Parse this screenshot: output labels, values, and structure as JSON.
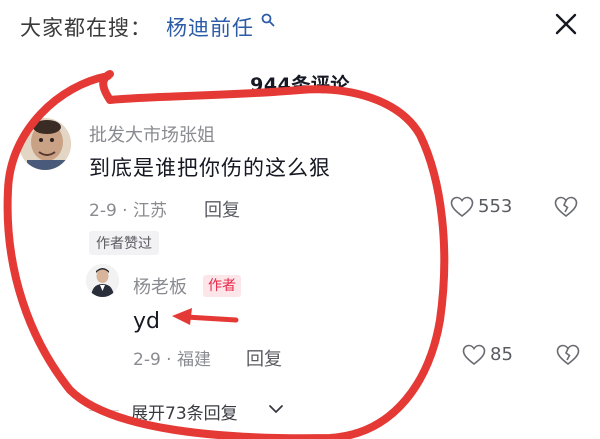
{
  "search": {
    "prefix": "大家都在搜：",
    "keyword": "杨迪前任"
  },
  "comments_header": {
    "count_label": "944条评论"
  },
  "comment": {
    "username": "批发大市场张姐",
    "text": "到底是谁把你伤的这么狠",
    "date_location": "2-9 · 江苏",
    "reply_label": "回复",
    "like_count": "553",
    "liked_by_author_badge": "作者赞过"
  },
  "reply": {
    "username": "杨老板",
    "author_badge": "作者",
    "text": "yd",
    "date_location": "2-9 · 福建",
    "reply_label": "回复",
    "like_count": "85"
  },
  "expand": {
    "label": "展开73条回复"
  },
  "colors": {
    "keyword": "#2c5ba8",
    "author_badge_bg": "#fde6ea",
    "author_badge_text": "#e8284a",
    "annotation_red": "#e53935"
  },
  "icons": {
    "search": "search-icon",
    "close": "close-icon",
    "like": "heart-icon",
    "dislike": "broken-heart-icon",
    "expand": "chevron-down-icon"
  }
}
